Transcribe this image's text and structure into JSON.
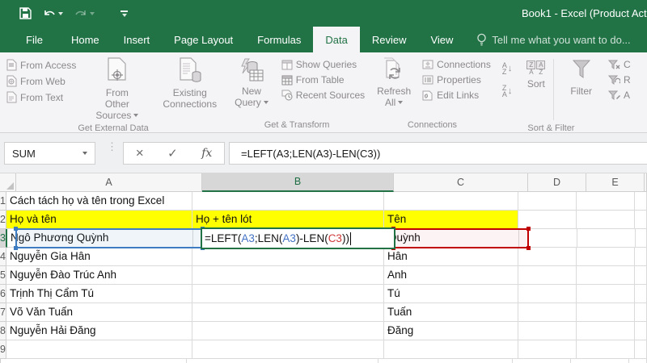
{
  "titlebar": {
    "title": "Book1 - Excel (Product Act"
  },
  "tabs": {
    "items": [
      "File",
      "Home",
      "Insert",
      "Page Layout",
      "Formulas",
      "Data",
      "Review",
      "View"
    ],
    "active": "Data",
    "tellme": "Tell me what you want to do..."
  },
  "ribbon": {
    "external": {
      "label": "Get External Data",
      "from_access": "From Access",
      "from_web": "From Web",
      "from_text": "From Text",
      "from_other_1": "From Other",
      "from_other_2": "Sources",
      "existing_1": "Existing",
      "existing_2": "Connections"
    },
    "transform": {
      "label": "Get & Transform",
      "new_1": "New",
      "new_2": "Query",
      "show_queries": "Show Queries",
      "from_table": "From Table",
      "recent_sources": "Recent Sources"
    },
    "connections": {
      "label": "Connections",
      "refresh_1": "Refresh",
      "refresh_2": "All",
      "connections": "Connections",
      "properties": "Properties",
      "edit_links": "Edit Links"
    },
    "sort_filter": {
      "label": "Sort & Filter",
      "sort": "Sort",
      "filter": "Filter",
      "az_a": "A",
      "az_z": "Z",
      "za_z": "Z",
      "za_a": "A",
      "clear_fragment": "C",
      "reapply_fragment": "R",
      "advanced_fragment": "A"
    }
  },
  "formula_bar": {
    "name_box": "SUM",
    "cancel": "×",
    "enter": "✓",
    "fx": "fx",
    "formula": "=LEFT(A3;LEN(A3)-LEN(C3))"
  },
  "sheet": {
    "col_headers": [
      "A",
      "B",
      "C",
      "D",
      "E"
    ],
    "row_headers": [
      "1",
      "2",
      "3",
      "4",
      "5",
      "6",
      "7",
      "8",
      "9"
    ],
    "cells": {
      "A1": "Cách tách họ và tên trong Excel",
      "A2": "Họ và tên",
      "B2": "Họ + tên lót",
      "C2": "Tên",
      "A3": "Ngô Phương Quỳnh",
      "C3": "Quỳnh",
      "A4": "Nguyễn Gia Hân",
      "C4": "Hân",
      "A5": "Nguyễn Đào Trúc Anh",
      "C5": "Anh",
      "A6": "Trịnh Thị Cẩm Tú",
      "C6": "Tú",
      "A7": "Võ Văn Tuấn",
      "C7": "Tuấn",
      "A8": "Nguyễn Hải Đăng",
      "C8": "Đăng"
    },
    "formula_parts": [
      "=LEFT(",
      "A3",
      ";LEN(",
      "A3",
      ")-LEN(",
      "C3",
      "))"
    ]
  },
  "colors": {
    "accent_green": "#217346",
    "highlight_yellow": "#ffff00",
    "ref_blue": "#4472c4",
    "ref_red": "#d03a3a",
    "selection_blue": "#3e7cc2",
    "selection_red": "#c00000"
  }
}
